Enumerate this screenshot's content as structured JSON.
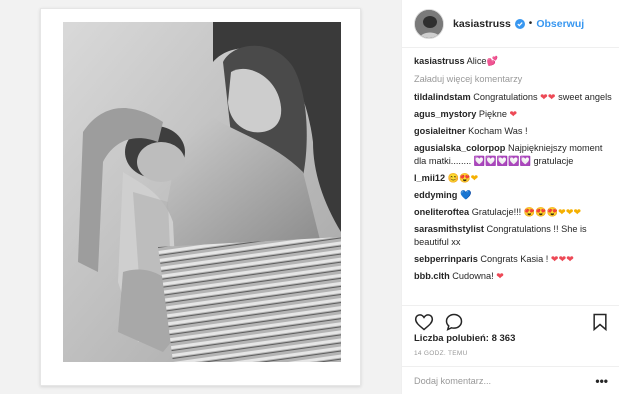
{
  "header": {
    "username": "kasiastruss",
    "separator": "•",
    "follow_label": "Obserwuj"
  },
  "caption": {
    "user": "kasiastruss",
    "text": "Alice",
    "emoji": "💕"
  },
  "load_more": "Załaduj więcej komentarzy",
  "comments": [
    {
      "user": "tildalindstam",
      "text": "Congratulations",
      "emoji": "❤❤",
      "text2": "sweet angels"
    },
    {
      "user": "agus_mystory",
      "text": "Piękne",
      "emoji": "❤"
    },
    {
      "user": "gosialeitner",
      "text": "Kocham Was !"
    },
    {
      "user": "agusialska_colorpop",
      "text": "Najpiękniejszy moment dla matki........",
      "emoji": "💟💟💟💟💟",
      "text2": "gratulacje"
    },
    {
      "user": "l_mii12",
      "emoji": "😊😍❤"
    },
    {
      "user": "eddyming",
      "emoji": "💙"
    },
    {
      "user": "oneliteroftea",
      "text": "Gratulacje!!!",
      "emoji": "😍😍😍❤❤❤"
    },
    {
      "user": "sarasmithstylist",
      "text": "Congratulations !! She is beautiful xx"
    },
    {
      "user": "sebperrinparis",
      "text": "Congrats Kasia !",
      "emoji": "❤❤❤"
    },
    {
      "user": "bbb.clth",
      "text": "Cudowna!",
      "emoji": "❤"
    }
  ],
  "likes_text": "Liczba polubień: 8 363",
  "time_text": "14 GODZ. TEMU",
  "add_comment_placeholder": "Dodaj komentarz...",
  "more_options": "•••",
  "icons": {
    "like": "heart-outline-icon",
    "comment": "speech-bubble-icon",
    "save": "bookmark-icon",
    "verified": "verified-badge-icon"
  },
  "colors": {
    "accent": "#3897f0",
    "heart": "#ed4956",
    "text": "#262626",
    "muted": "#999999",
    "border": "#efefef"
  }
}
